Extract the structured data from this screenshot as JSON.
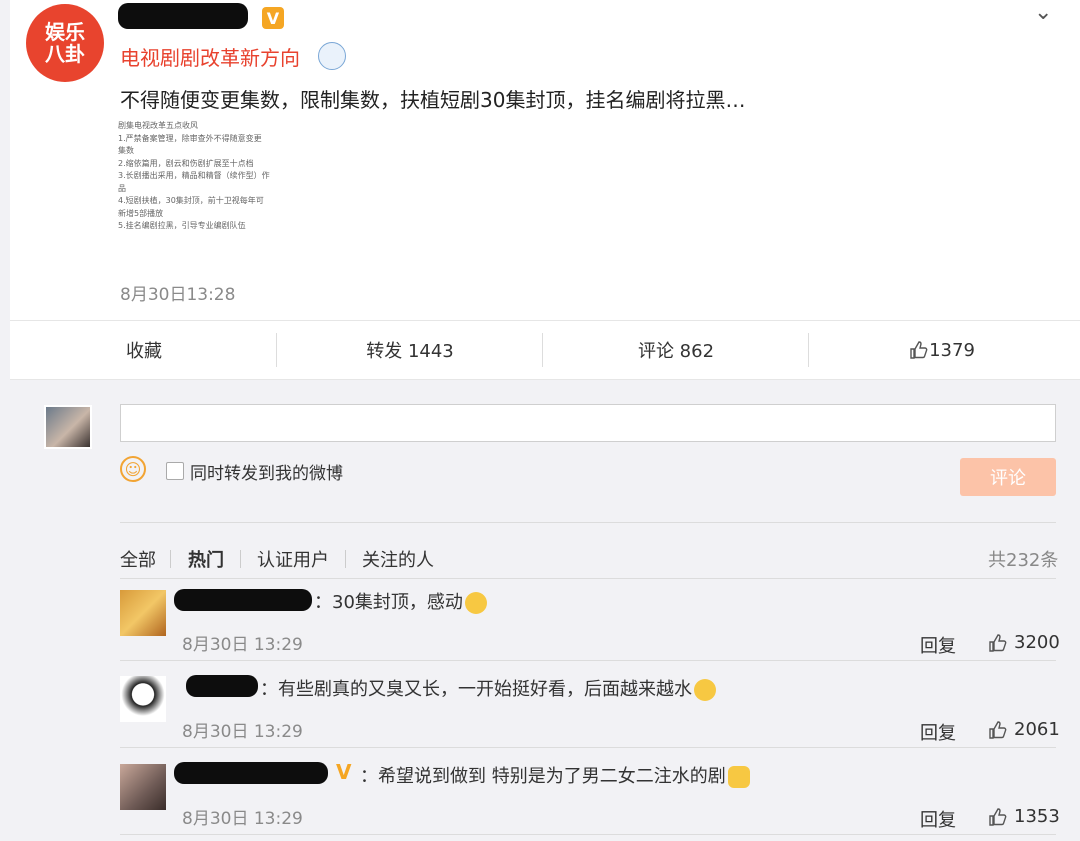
{
  "post": {
    "avatar_text_top": "娱乐",
    "avatar_text_bottom": "八卦",
    "topic": "电视剧剧改革新方向",
    "text": "不得随便变更集数，限制集数，扶植短剧30集封顶，挂名编剧将拉黑…",
    "image_lines": [
      "剧集电视改革五点收风",
      "1.严禁备案管理，除审查外不得随意变更",
      "集数",
      "2.缩依篇用，剧云和伤剧扩展至十点档",
      "3.长剧播出采用，精品和精督（续作型）作",
      "品",
      "4.短剧扶植，30集封顶，前十卫视每年可",
      "新增5部播放",
      "5.挂名编剧拉黑，引导专业编剧队伍"
    ],
    "time": "8月30日13:28"
  },
  "actions": {
    "favorite": "收藏",
    "repost": "转发 1443",
    "comment": "评论 862",
    "like": "1379"
  },
  "composer": {
    "input_value": "",
    "repost_label": "同时转发到我的微博",
    "submit_label": "评论"
  },
  "filters": {
    "tabs": [
      "全部",
      "热门",
      "认证用户",
      "关注的人"
    ],
    "active": "热门",
    "total": "共232条"
  },
  "comments": [
    {
      "text": "：30集封顶，感动",
      "time": "8月30日 13:29",
      "reply": "回复",
      "likes": "3200"
    },
    {
      "text": "：有些剧真的又臭又长，一开始挺好看，后面越来越水",
      "time": "8月30日 13:29",
      "reply": "回复",
      "likes": "2061"
    },
    {
      "text": "：希望说到做到 特别是为了男二女二注水的剧",
      "time": "8月30日 13:29",
      "reply": "回复",
      "likes": "1353"
    }
  ],
  "colors": {
    "accent": "#e8422e",
    "verify": "#f5a623",
    "submit_disabled": "#fcc3a8"
  }
}
